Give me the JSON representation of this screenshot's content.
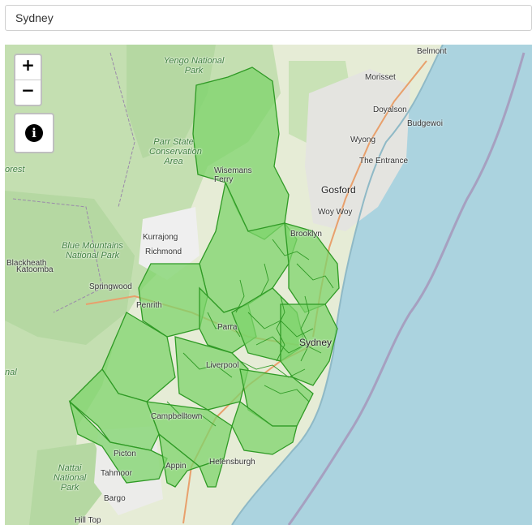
{
  "search": {
    "value": "Sydney"
  },
  "zoom": {
    "in_label": "+",
    "out_label": "−"
  },
  "info": {
    "icon": "info-icon",
    "glyph": "i"
  },
  "colors": {
    "water": "#abd3df",
    "land": "#e6ecd6",
    "park": "#b5d8a2",
    "region_fill": "#7ed46b",
    "region_stroke": "#2f9a25",
    "urban": "#efefef"
  },
  "places": {
    "yengo": "Yengo National Park",
    "belmont": "Belmont",
    "morisset": "Morisset",
    "doyalson": "Doyalson",
    "budgewoi": "Budgewoi",
    "parr": "Parr State Conservation Area",
    "wyong": "Wyong",
    "the_entrance": "The Entrance",
    "wisemans": "Wisemans Ferry",
    "forest": "orest",
    "gosford": "Gosford",
    "woy_woy": "Woy Woy",
    "kurrajong": "Kurrajong",
    "brooklyn": "Brooklyn",
    "blue_mountains": "Blue Mountains National Park",
    "richmond": "Richmond",
    "blackheath": "Blackheath",
    "katoomba": "Katoomba",
    "springwood": "Springwood",
    "penrith": "Penrith",
    "parramatta": "Parra",
    "sydney": "Sydney",
    "liverpool": "Liverpool",
    "campbelltown": "Campbelltown",
    "picton": "Picton",
    "nattai": "Nattai National Park",
    "tahmoor": "Tahmoor",
    "appin": "Appin",
    "helensburgh": "Helensburgh",
    "bargo": "Bargo",
    "hill_top": "Hill Top",
    "nal": "nal"
  }
}
